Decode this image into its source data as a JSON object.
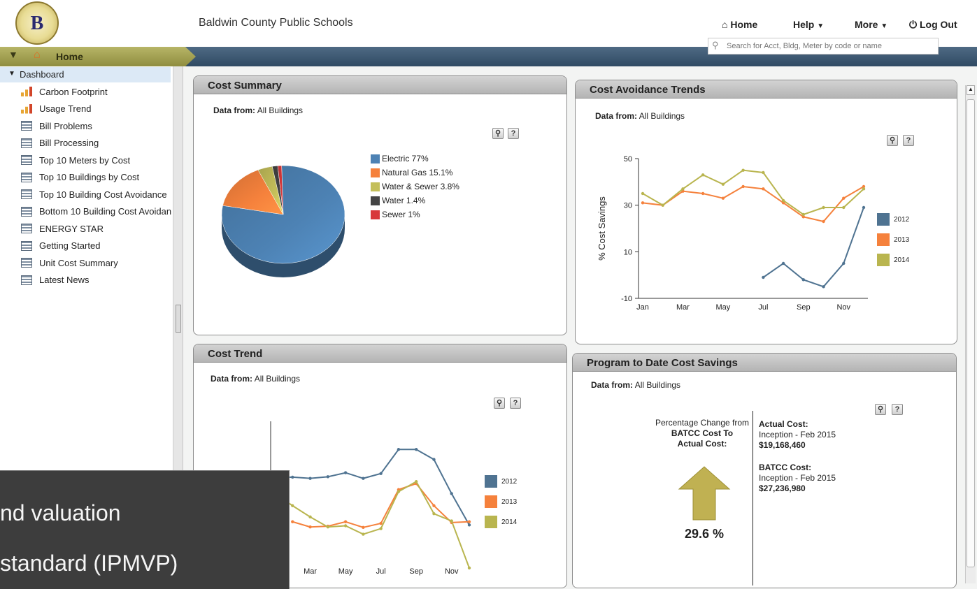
{
  "header": {
    "logo_letter": "B",
    "app_title": "Baldwin County Public Schools",
    "nav": {
      "home": "Home",
      "help": "Help",
      "more": "More",
      "logout": "Log Out"
    },
    "search_placeholder": "Search for Acct, Bldg, Meter by code or name"
  },
  "home_tab": {
    "label": "Home"
  },
  "sidebar": {
    "section": "Dashboard",
    "items": [
      {
        "label": "Carbon Footprint",
        "icon": "bar-chart-icon"
      },
      {
        "label": "Usage Trend",
        "icon": "bar-chart-icon"
      },
      {
        "label": "Bill Problems",
        "icon": "table-icon"
      },
      {
        "label": "Bill Processing",
        "icon": "table-icon"
      },
      {
        "label": "Top 10 Meters by Cost",
        "icon": "table-icon"
      },
      {
        "label": "Top 10 Buildings by Cost",
        "icon": "table-icon"
      },
      {
        "label": "Top 10 Building Cost Avoidance",
        "icon": "table-icon"
      },
      {
        "label": "Bottom 10 Building Cost Avoidan",
        "icon": "table-icon"
      },
      {
        "label": "ENERGY STAR",
        "icon": "table-icon"
      },
      {
        "label": "Getting Started",
        "icon": "table-icon"
      },
      {
        "label": "Unit Cost Summary",
        "icon": "table-icon"
      },
      {
        "label": "Latest News",
        "icon": "table-icon"
      }
    ]
  },
  "panels": {
    "cost_summary": {
      "title": "Cost Summary",
      "data_from_label": "Data from:",
      "data_from_value": "All Buildings"
    },
    "cost_avoidance": {
      "title": "Cost Avoidance Trends",
      "data_from_label": "Data from:",
      "data_from_value": "All Buildings"
    },
    "cost_trend": {
      "title": "Cost Trend",
      "data_from_label": "Data from:",
      "data_from_value": "All Buildings"
    },
    "program_savings": {
      "title": "Program to Date Cost Savings",
      "data_from_label": "Data from:",
      "data_from_value": "All Buildings",
      "pct_label_1": "Percentage Change from",
      "pct_label_2": "BATCC Cost To",
      "pct_label_3": "Actual Cost:",
      "pct_value": "29.6 %",
      "actual_title": "Actual Cost:",
      "actual_period": "Inception - Feb 2015",
      "actual_value": "$19,168,460",
      "batcc_title": "BATCC Cost:",
      "batcc_period": "Inception - Feb 2015",
      "batcc_value": "$27,236,980"
    }
  },
  "overlay": {
    "line1": "nd valuation",
    "line2": "standard (IPMVP)"
  },
  "colors": {
    "c2012": "#4f7391",
    "c2013": "#f5813c",
    "c2014": "#b9b54f",
    "water": "#444444",
    "sewer": "#d8393b"
  },
  "chart_data": [
    {
      "type": "pie",
      "labels": [
        "Electric 77%",
        "Natural Gas 15.1%",
        "Water & Sewer 3.8%",
        "Water 1.4%",
        "Sewer 1%"
      ],
      "values": [
        77,
        15.1,
        3.8,
        1.4,
        1
      ],
      "colors": [
        "#4d82b4",
        "#f5813c",
        "#c4bf5a",
        "#444444",
        "#d8393b"
      ],
      "legend": "right"
    },
    {
      "type": "line",
      "ylabel": "% Cost Savings",
      "x": [
        "Jan",
        "Feb",
        "Mar",
        "Apr",
        "May",
        "Jun",
        "Jul",
        "Aug",
        "Sep",
        "Oct",
        "Nov",
        "Dec"
      ],
      "xticks": [
        "Jan",
        "Mar",
        "May",
        "Jul",
        "Sep",
        "Nov"
      ],
      "ylim": [
        -10,
        50
      ],
      "yticks": [
        -10,
        10,
        30,
        50
      ],
      "series": [
        {
          "name": "2012",
          "values": [
            null,
            null,
            null,
            null,
            null,
            null,
            -1,
            5,
            -2,
            -5,
            5,
            29
          ]
        },
        {
          "name": "2013",
          "values": [
            31,
            30,
            36,
            35,
            33,
            38,
            37,
            31,
            25,
            23,
            33,
            38
          ]
        },
        {
          "name": "2014",
          "values": [
            35,
            30,
            37,
            43,
            39,
            45,
            44,
            32,
            26,
            29,
            29,
            37
          ]
        }
      ],
      "legend": "right"
    },
    {
      "type": "line",
      "x": [
        "Jan",
        "Feb",
        "Mar",
        "Apr",
        "May",
        "Jun",
        "Jul",
        "Aug",
        "Sep",
        "Oct",
        "Nov",
        "Dec"
      ],
      "xticks": [
        "Mar",
        "May",
        "Jul",
        "Sep",
        "Nov"
      ],
      "yticks": [
        800000
      ],
      "ylim": [
        550000,
        950000
      ],
      "series": [
        {
          "name": "2012",
          "values": [
            810000,
            811000,
            808000,
            812000,
            822000,
            808000,
            820000,
            880000,
            880000,
            855000,
            770000,
            692000
          ]
        },
        {
          "name": "2013",
          "values": [
            null,
            700000,
            687000,
            689000,
            700000,
            686000,
            696000,
            780000,
            795000,
            740000,
            698000,
            700000
          ]
        },
        {
          "name": "2014",
          "values": [
            770000,
            740000,
            712000,
            687000,
            690000,
            669000,
            683000,
            775000,
            800000,
            720000,
            702000,
            585000
          ]
        }
      ],
      "legend": "right"
    }
  ]
}
